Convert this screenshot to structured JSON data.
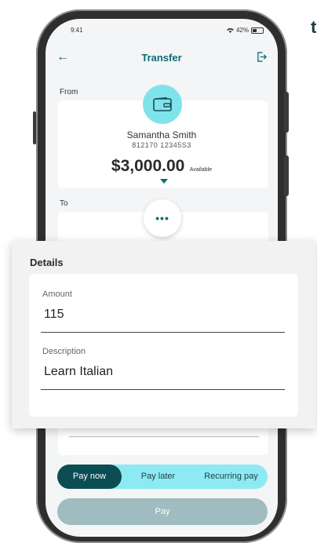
{
  "corner_text": "t",
  "status": {
    "time": "9:41",
    "battery_percent": "42%"
  },
  "header": {
    "title": "Transfer"
  },
  "from": {
    "label": "From",
    "name": "Samantha Smith",
    "account": "812170  12345S3",
    "balance": "$3,000.00",
    "balance_note": "Available"
  },
  "to": {
    "label": "To",
    "more_label": "•••"
  },
  "details": {
    "title": "Details",
    "amount_label": "Amount",
    "amount_value": "115",
    "description_label": "Description",
    "description_value": "Learn Italian"
  },
  "payment_options": [
    "Pay now",
    "Pay later",
    "Recurring pay"
  ],
  "pay_button": "Pay",
  "colors": {
    "accent": "#0f6b73",
    "segment_bg": "#8deaf3",
    "active_segment": "#0c4d53",
    "pay_disabled": "#9fbcc0"
  }
}
